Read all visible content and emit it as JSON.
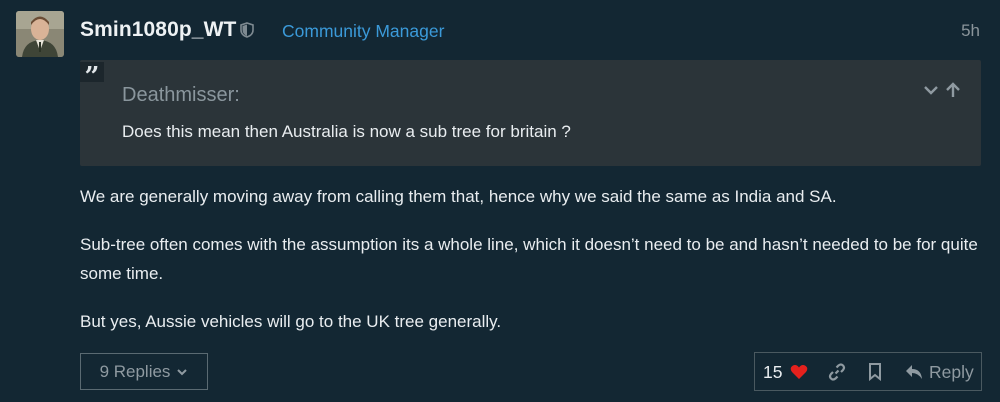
{
  "post": {
    "username": "Smin1080p_WT",
    "user_title": "Community Manager",
    "time": "5h",
    "quote": {
      "author": "Deathmisser:",
      "text": "Does this mean then Australia is now a sub tree for britain ?"
    },
    "paragraphs": [
      "We are generally moving away from calling them that, hence why we said the same as India and SA.",
      "Sub-tree often comes with the assumption its a whole line, which it doesn’t need to be and hasn’t needed to be for quite some time.",
      "But yes, Aussie vehicles will go to the UK tree generally."
    ],
    "replies_label": "9 Replies",
    "like_count": "15",
    "reply_label": "Reply"
  },
  "icons": {
    "shield": "shield-icon",
    "quote": "quote-icon",
    "expand": "chevron-down-icon",
    "jump": "arrow-up-icon",
    "replies_toggle": "chevron-down-icon",
    "like": "heart-icon",
    "link": "link-icon",
    "bookmark": "bookmark-icon",
    "reply": "reply-arrow-icon"
  },
  "colors": {
    "background": "#132733",
    "quote_background": "#2b3439",
    "user_title": "#3b9ad9",
    "heart": "#e5211d",
    "muted_text": "#8f9aa1"
  }
}
